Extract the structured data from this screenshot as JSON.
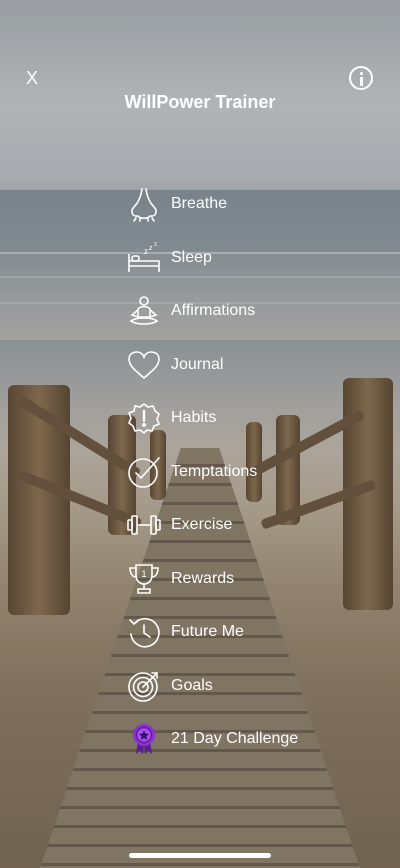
{
  "header": {
    "close_label": "X",
    "title": "WillPower Trainer"
  },
  "menu": {
    "items": [
      {
        "label": "Breathe",
        "icon": "nose-icon"
      },
      {
        "label": "Sleep",
        "icon": "bed-icon"
      },
      {
        "label": "Affirmations",
        "icon": "meditation-icon"
      },
      {
        "label": "Journal",
        "icon": "heart-icon"
      },
      {
        "label": "Habits",
        "icon": "alert-badge-icon"
      },
      {
        "label": "Temptations",
        "icon": "clock-check-icon"
      },
      {
        "label": "Exercise",
        "icon": "dumbbell-icon"
      },
      {
        "label": "Rewards",
        "icon": "trophy-icon"
      },
      {
        "label": "Future Me",
        "icon": "future-clock-icon"
      },
      {
        "label": "Goals",
        "icon": "target-icon"
      },
      {
        "label": "21 Day Challenge",
        "icon": "medal-icon"
      }
    ]
  },
  "colors": {
    "text": "#ffffff",
    "medal": "#8b2fd6"
  }
}
